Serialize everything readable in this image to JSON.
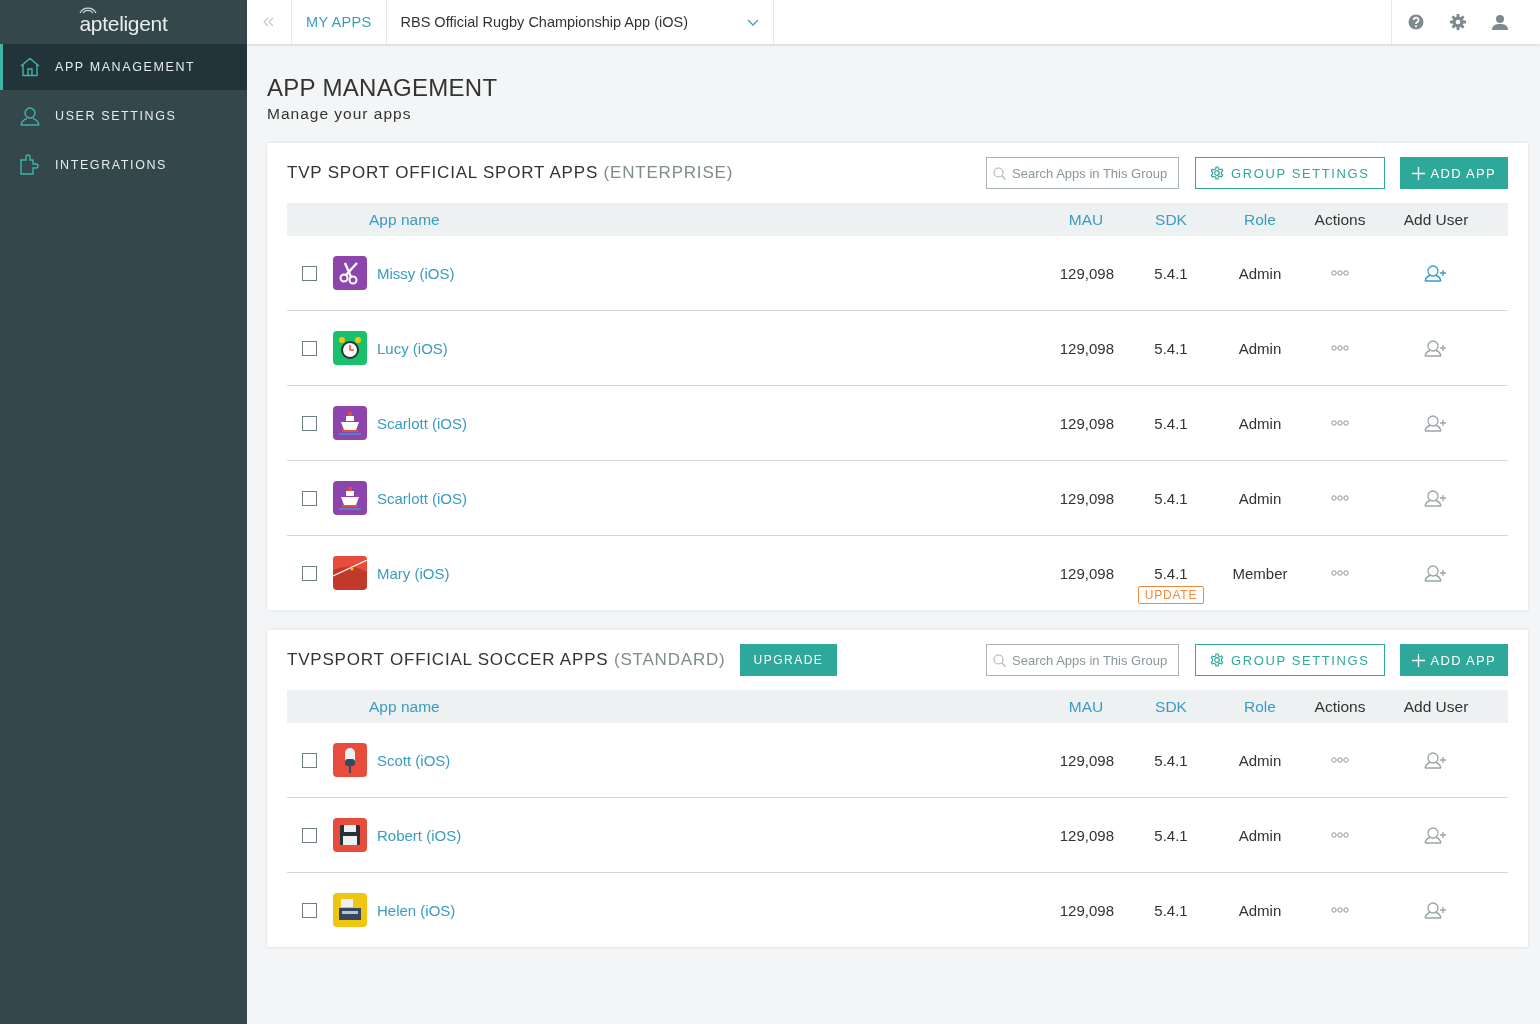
{
  "sidebar": {
    "logo": "apteligent",
    "items": [
      {
        "label": "APP MANAGEMENT",
        "kind": "home",
        "selected": true
      },
      {
        "label": "USER SETTINGS",
        "kind": "user",
        "selected": false
      },
      {
        "label": "INTEGRATIONS",
        "kind": "puzzle",
        "selected": false
      }
    ]
  },
  "topbar": {
    "breadcrumb": "MY APPS",
    "app_selector": "RBS Official Rugby Championship App (iOS)"
  },
  "page": {
    "title": "APP MANAGEMENT",
    "subtitle": "Manage your apps"
  },
  "groups": [
    {
      "name": "TVP SPORT OFFICIAL SPORT APPS",
      "tier": "(ENTERPRISE)",
      "search": {
        "placeholder": "Search Apps in This Group"
      },
      "group_settings": "GROUP SETTINGS",
      "add_app": "ADD APP",
      "columns": [
        {
          "label": "App name",
          "sortable": true
        },
        {
          "label": "MAU",
          "sortable": true
        },
        {
          "label": "SDK",
          "sortable": true
        },
        {
          "label": "Role",
          "sortable": true
        },
        {
          "label": "Actions",
          "sortable": false
        },
        {
          "label": "Add User",
          "sortable": false
        }
      ],
      "rows": [
        {
          "name": "Missy (iOS)",
          "kind": "scissors",
          "mau": "129,098",
          "sdk": "5.4.1",
          "role": "Admin",
          "checked": false,
          "add_user_active": true
        },
        {
          "name": "Lucy (iOS)",
          "kind": "clock",
          "mau": "129,098",
          "sdk": "5.4.1",
          "role": "Admin",
          "checked": false,
          "add_user_active": false
        },
        {
          "name": "Scarlott (iOS)",
          "kind": "ship",
          "mau": "129,098",
          "sdk": "5.4.1",
          "role": "Admin",
          "checked": false,
          "add_user_active": false
        },
        {
          "name": "Scarlott (iOS)",
          "kind": "ship",
          "mau": "129,098",
          "sdk": "5.4.1",
          "role": "Admin",
          "checked": false,
          "add_user_active": false
        },
        {
          "name": "Mary (iOS)",
          "kind": "chart",
          "mau": "129,098",
          "sdk": "5.4.1",
          "update": "UPDATE",
          "role": "Member",
          "checked": false,
          "add_user_active": false
        }
      ]
    },
    {
      "name": "TVPSPORT OFFICIAL SOCCER APPS",
      "tier": "(STANDARD)",
      "upgrade": "UPGRADE",
      "search": {
        "placeholder": "Search Apps in This Group"
      },
      "group_settings": "GROUP SETTINGS",
      "add_app": "ADD APP",
      "columns": [
        {
          "label": "App name",
          "sortable": true
        },
        {
          "label": "MAU",
          "sortable": true
        },
        {
          "label": "SDK",
          "sortable": true
        },
        {
          "label": "Role",
          "sortable": true
        },
        {
          "label": "Actions",
          "sortable": false
        },
        {
          "label": "Add User",
          "sortable": false
        }
      ],
      "rows": [
        {
          "name": "Scott (iOS)",
          "kind": "microphone",
          "mau": "129,098",
          "sdk": "5.4.1",
          "role": "Admin",
          "checked": false,
          "add_user_active": false
        },
        {
          "name": "Robert (iOS)",
          "kind": "floppy",
          "mau": "129,098",
          "sdk": "5.4.1",
          "role": "Admin",
          "checked": false,
          "add_user_active": false
        },
        {
          "name": "Helen (iOS)",
          "kind": "register",
          "mau": "129,098",
          "sdk": "5.4.1",
          "role": "Admin",
          "checked": false,
          "add_user_active": false
        }
      ]
    }
  ]
}
